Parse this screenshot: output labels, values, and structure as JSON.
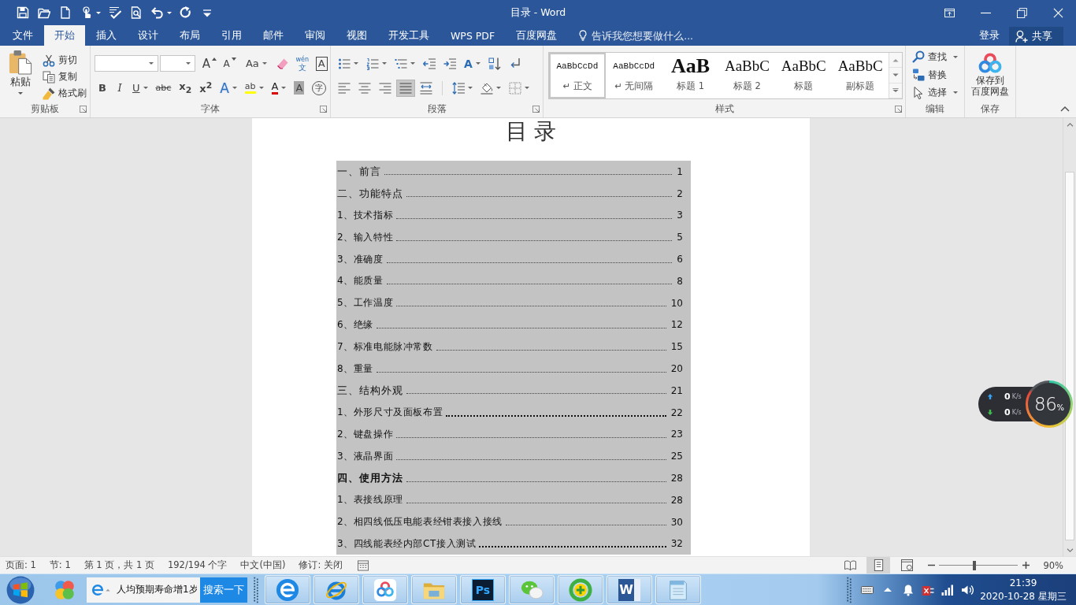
{
  "title_bar": {
    "title": "目录 - Word",
    "qat": [
      {
        "kind": "save"
      },
      {
        "kind": "open"
      },
      {
        "kind": "new"
      },
      {
        "kind": "touch",
        "dropdown": true
      },
      {
        "kind": "spelling"
      },
      {
        "kind": "preview"
      },
      {
        "kind": "undo",
        "dropdown": true
      },
      {
        "kind": "redo"
      },
      {
        "kind": "customize"
      }
    ]
  },
  "tabs": [
    {
      "label": "文件",
      "selected": false
    },
    {
      "label": "开始",
      "selected": true
    },
    {
      "label": "插入",
      "selected": false
    },
    {
      "label": "设计",
      "selected": false
    },
    {
      "label": "布局",
      "selected": false
    },
    {
      "label": "引用",
      "selected": false
    },
    {
      "label": "邮件",
      "selected": false
    },
    {
      "label": "审阅",
      "selected": false
    },
    {
      "label": "视图",
      "selected": false
    },
    {
      "label": "开发工具",
      "selected": false
    },
    {
      "label": "WPS PDF",
      "selected": false
    },
    {
      "label": "百度网盘",
      "selected": false
    }
  ],
  "tell_me": {
    "placeholder": "告诉我您想要做什么..."
  },
  "account": {
    "sign_in": "登录",
    "share": "共享"
  },
  "ribbon": {
    "clipboard": {
      "label": "剪贴板",
      "paste": "粘贴",
      "actions": [
        {
          "kind": "cut",
          "label": "剪切"
        },
        {
          "kind": "copy",
          "label": "复制"
        },
        {
          "kind": "brush",
          "label": "格式刷"
        }
      ]
    },
    "font": {
      "label": "字体",
      "row1": [
        {
          "kind": "grow",
          "glyph": "A"
        },
        {
          "kind": "shrink",
          "glyph": "A"
        },
        {
          "kind": "case",
          "glyph": "Aa",
          "dropdown": true
        },
        {
          "kind": "clear"
        },
        {
          "kind": "phonetic",
          "glyph": "wén",
          "glyph_below": "文"
        },
        {
          "kind": "border",
          "glyph": "A"
        }
      ],
      "row2": [
        {
          "kind": "bold",
          "glyph": "B"
        },
        {
          "kind": "italic",
          "glyph": "I"
        },
        {
          "kind": "underline",
          "glyph": "U",
          "dropdown": true
        },
        {
          "kind": "strike",
          "glyph": "abc"
        },
        {
          "kind": "sub",
          "glyph": "x$_{2}$"
        },
        {
          "kind": "sup",
          "glyph": "x$^{2}$"
        },
        {
          "kind": "effect",
          "glyph": "A",
          "dropdown": true
        },
        {
          "kind": "highlight",
          "glyph": "ab",
          "dropdown": true
        },
        {
          "kind": "color",
          "glyph": "A",
          "dropdown": true
        },
        {
          "kind": "shading",
          "glyph": "A"
        },
        {
          "kind": "enclose",
          "glyph": "字"
        }
      ]
    },
    "paragraph": {
      "label": "段落",
      "row1": [
        {
          "kind": "bullets",
          "dropdown": true
        },
        {
          "kind": "numbering",
          "dropdown": true
        },
        {
          "kind": "multilevel",
          "dropdown": true
        },
        {
          "kind": "outdent"
        },
        {
          "kind": "indent"
        },
        {
          "kind": "asian",
          "glyph": "A",
          "dropdown": true
        },
        {
          "kind": "sort"
        },
        {
          "kind": "marks"
        }
      ],
      "alignment": [
        {
          "kind": "left",
          "selected": false
        },
        {
          "kind": "center",
          "selected": false
        },
        {
          "kind": "right",
          "selected": false
        },
        {
          "kind": "justify",
          "selected": true
        },
        {
          "kind": "distribute",
          "selected": false
        }
      ],
      "row2": [
        {
          "kind": "spacing",
          "dropdown": true
        },
        {
          "kind": "fill",
          "dropdown": true
        },
        {
          "kind": "borders",
          "dropdown": true
        }
      ]
    },
    "styles": {
      "label": "样式",
      "items": [
        {
          "kind": "body",
          "preview": "AaBbCcDd",
          "name": "↵ 正文",
          "selected": true
        },
        {
          "kind": "body",
          "preview": "AaBbCcDd",
          "name": "↵ 无间隔",
          "selected": false
        },
        {
          "kind": "heading1",
          "preview": "AaB",
          "name": "标题 1",
          "selected": false
        },
        {
          "kind": "heading",
          "preview": "AaBbC",
          "name": "标题 2",
          "selected": false
        },
        {
          "kind": "heading",
          "preview": "AaBbC",
          "name": "标题",
          "selected": false
        },
        {
          "kind": "heading",
          "preview": "AaBbC",
          "name": "副标题",
          "selected": false
        }
      ]
    },
    "editing": {
      "label": "编辑",
      "items": [
        {
          "kind": "find",
          "label": "查找",
          "dropdown": true
        },
        {
          "kind": "replace",
          "label": "替换"
        },
        {
          "kind": "select",
          "label": "选择",
          "dropdown": true
        }
      ]
    },
    "save": {
      "label": "保存",
      "button_lines": [
        "保存到",
        "百度网盘"
      ]
    }
  },
  "document": {
    "title": "目 录",
    "toc": [
      {
        "kind": "chapter",
        "text": "一、前言",
        "page": "1",
        "bold": false,
        "dense_leader": false
      },
      {
        "kind": "chapter",
        "text": "二、功能特点",
        "page": "2",
        "bold": false,
        "dense_leader": false
      },
      {
        "kind": "section",
        "text": "1、技术指标",
        "page": "3",
        "bold": false,
        "dense_leader": false
      },
      {
        "kind": "section",
        "text": "2、输入特性",
        "page": "5",
        "bold": false,
        "dense_leader": false
      },
      {
        "kind": "section",
        "text": "3、准确度",
        "page": "6",
        "bold": false,
        "dense_leader": false
      },
      {
        "kind": "section",
        "text": "4、能质量",
        "page": "8",
        "bold": false,
        "dense_leader": false
      },
      {
        "kind": "section",
        "text": "5、工作温度",
        "page": "10",
        "bold": false,
        "dense_leader": false
      },
      {
        "kind": "section",
        "text": "6、绝缘",
        "page": "12",
        "bold": false,
        "dense_leader": false
      },
      {
        "kind": "section",
        "text": "7、标准电能脉冲常数",
        "page": "15",
        "bold": false,
        "dense_leader": false
      },
      {
        "kind": "section",
        "text": "8、重量",
        "page": "20",
        "bold": false,
        "dense_leader": false
      },
      {
        "kind": "chapter",
        "text": "三、结构外观",
        "page": "21",
        "bold": false,
        "dense_leader": false
      },
      {
        "kind": "section",
        "text": "1、外形尺寸及面板布置",
        "page": "22",
        "bold": false,
        "dense_leader": true
      },
      {
        "kind": "section",
        "text": "2、键盘操作",
        "page": "23",
        "bold": false,
        "dense_leader": false
      },
      {
        "kind": "section",
        "text": "3、液晶界面",
        "page": "25",
        "bold": false,
        "dense_leader": false
      },
      {
        "kind": "chapter",
        "text": "四、使用方法",
        "page": "28",
        "bold": true,
        "dense_leader": false
      },
      {
        "kind": "section",
        "text": "1、表接线原理",
        "page": "28",
        "bold": false,
        "dense_leader": false
      },
      {
        "kind": "section",
        "text": "2、相四线低压电能表经钳表接入接线",
        "page": "30",
        "bold": false,
        "dense_leader": false
      },
      {
        "kind": "section",
        "text": "3、四线能表经内部CT接入测试",
        "page": "32",
        "bold": false,
        "dense_leader": true
      }
    ]
  },
  "status_bar": {
    "items": [
      "页面: 1",
      "节: 1",
      "第 1 页，共 1 页",
      "192/194 个字",
      "中文(中国)",
      "修订: 关闭"
    ],
    "views": [
      {
        "kind": "read",
        "selected": false
      },
      {
        "kind": "print",
        "selected": true
      },
      {
        "kind": "web",
        "selected": false
      }
    ],
    "zoom": {
      "level": 0.45,
      "label": "90%"
    }
  },
  "taskbar": {
    "search": {
      "value": "人均预期寿命增1岁",
      "button": "搜索一下"
    },
    "apps": [
      {
        "kind": "ecircle"
      },
      {
        "kind": "eorbit"
      },
      {
        "kind": "cloud"
      },
      {
        "kind": "folder"
      },
      {
        "kind": "ps",
        "glyph": "Ps"
      },
      {
        "kind": "chat"
      },
      {
        "kind": "plusring"
      },
      {
        "kind": "word",
        "glyph": "W"
      },
      {
        "kind": "notepad"
      }
    ],
    "clock": {
      "time": "21:39",
      "date": "2020-10-28 星期三"
    }
  },
  "speed_widget": {
    "upload": "0",
    "upload_unit": "K/s",
    "download": "0",
    "download_unit": "K/s",
    "percent": "86",
    "percent_sign": "%"
  }
}
